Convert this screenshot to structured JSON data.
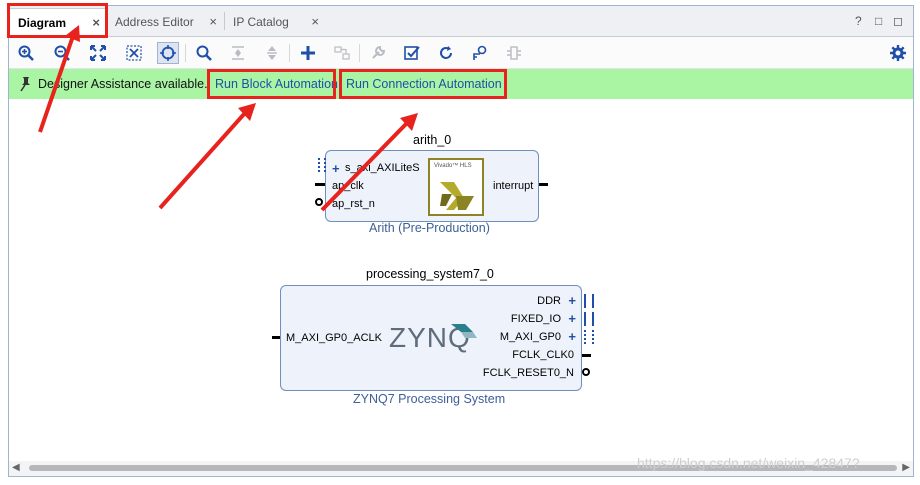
{
  "tabs": [
    {
      "label": "Diagram"
    },
    {
      "label": "Address Editor"
    },
    {
      "label": "IP Catalog"
    }
  ],
  "window_controls": {
    "help": "?",
    "restore": "□",
    "maximize": "◻"
  },
  "assist": {
    "message": "Designer Assistance available.",
    "run_block": "Run Block Automation",
    "run_connection": "Run Connection Automation"
  },
  "blocks": {
    "arith": {
      "instance": "arith_0",
      "subtitle": "Arith (Pre-Production)",
      "logo_text": "Vivado™ HLS",
      "ports_left": [
        "s_axi_AXILiteS",
        "ap_clk",
        "ap_rst_n"
      ],
      "ports_right": [
        "interrupt"
      ]
    },
    "zynq": {
      "instance": "processing_system7_0",
      "subtitle": "ZYNQ7 Processing System",
      "logo_text": "ZYNQ",
      "ports_left": [
        "M_AXI_GP0_ACLK"
      ],
      "ports_right": [
        "DDR",
        "FIXED_IO",
        "M_AXI_GP0",
        "FCLK_CLK0",
        "FCLK_RESET0_N"
      ]
    }
  },
  "watermark": "https://blog.csdn.net/weixin_42847?",
  "colors": {
    "assist_bg": "#a9f5a3",
    "link": "#1f4fa8",
    "annotation": "#e8221c"
  }
}
